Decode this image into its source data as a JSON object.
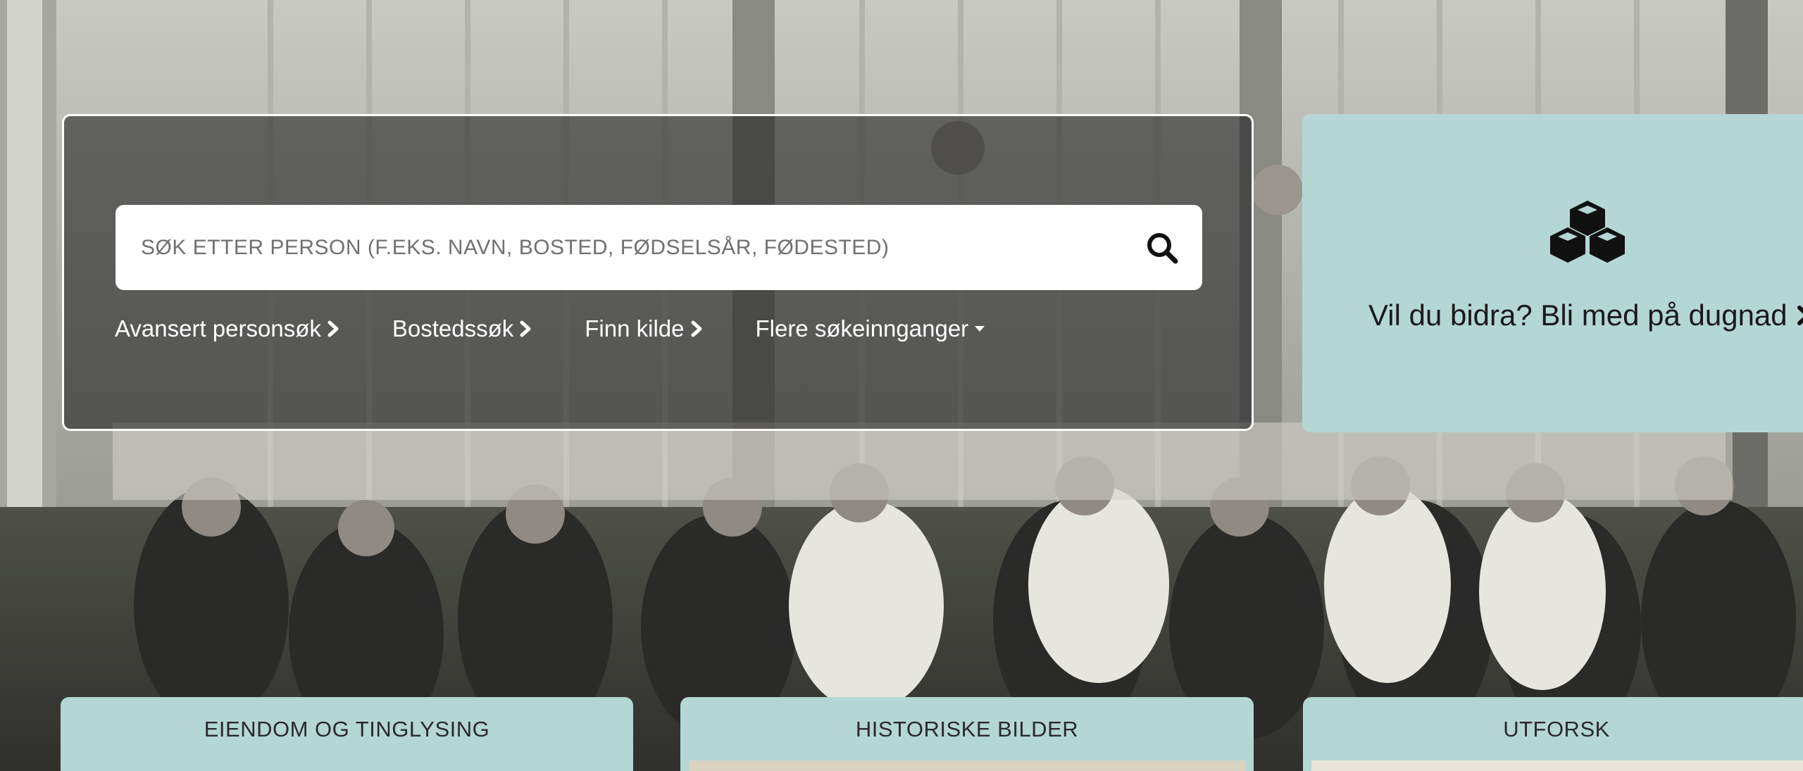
{
  "search": {
    "placeholder": "SØK ETTER PERSON (F.EKS. NAVN, BOSTED, FØDSELSÅR, FØDESTED)",
    "links": [
      {
        "label": "Avansert personsøk"
      },
      {
        "label": "Bostedssøk"
      },
      {
        "label": "Finn kilde"
      },
      {
        "label": "Flere søkeinnganger"
      }
    ]
  },
  "dugnad": {
    "icon": "cubes-icon",
    "label": "Vil du bidra? Bli med på dugnad"
  },
  "tiles": [
    {
      "title": "EIENDOM OG TINGLYSING"
    },
    {
      "title": "HISTORISKE BILDER"
    },
    {
      "title": "UTFORSK"
    }
  ],
  "colors": {
    "card_bg": "#b4d7d4",
    "panel_overlay": "#141414",
    "text_white": "#ffffff"
  }
}
